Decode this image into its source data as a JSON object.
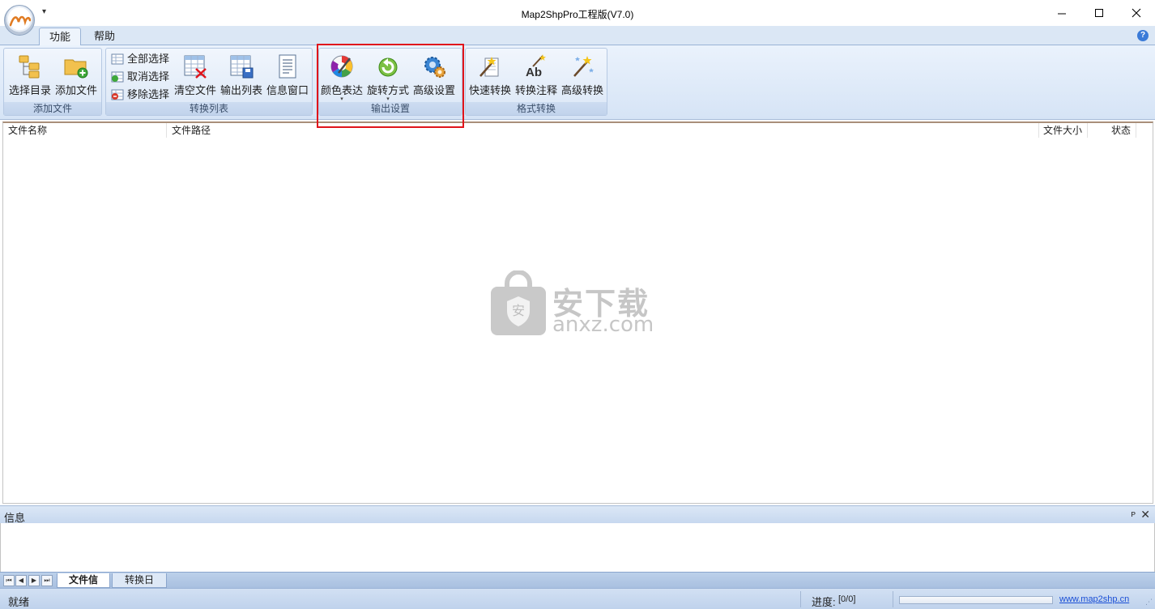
{
  "window": {
    "title": "Map2ShpPro工程版(V7.0)",
    "qat_glyph": "▾"
  },
  "tabs": [
    {
      "label": "功能"
    },
    {
      "label": "帮助"
    }
  ],
  "help_glyph": "?",
  "ribbon": {
    "groups": [
      {
        "label": "添加文件",
        "buttons": [
          {
            "label": "选择目录"
          },
          {
            "label": "添加文件"
          }
        ]
      },
      {
        "label": "转换列表",
        "small_buttons": [
          {
            "label": "全部选择"
          },
          {
            "label": "取消选择"
          },
          {
            "label": "移除选择"
          }
        ],
        "buttons": [
          {
            "label": "清空文件"
          },
          {
            "label": "输出列表"
          },
          {
            "label": "信息窗口"
          }
        ]
      },
      {
        "label": "输出设置",
        "buttons": [
          {
            "label": "颜色表达"
          },
          {
            "label": "旋转方式"
          },
          {
            "label": "高级设置"
          }
        ]
      },
      {
        "label": "格式转换",
        "buttons": [
          {
            "label": "快速转换"
          },
          {
            "label": "转换注释"
          },
          {
            "label": "高级转换"
          }
        ]
      }
    ],
    "dropdown_caret": "▾"
  },
  "file_list": {
    "columns": [
      "文件名称",
      "文件路径",
      "文件大小",
      "状态"
    ],
    "rows": []
  },
  "watermark": {
    "title": "安下载",
    "domain": "anxz.com",
    "badge": "安"
  },
  "info_panel": {
    "title": "信息",
    "pin_glyph": "ᴘ",
    "close_glyph": "✕"
  },
  "sheet_tabs": {
    "nav": [
      "⏮",
      "◀",
      "▶",
      "⏭"
    ],
    "tabs": [
      {
        "label": "文件信息"
      },
      {
        "label": "转换日志"
      }
    ]
  },
  "status": {
    "text": "就绪",
    "progress_label": "进度:",
    "progress_value": "[0/0]",
    "progress_fraction": 0,
    "website": "www.map2shp.cn",
    "grip": "⋰"
  },
  "colors": {
    "highlight": "#e0141b",
    "accent": "#3b7bd8",
    "ribbon": "#dbe7f5"
  }
}
